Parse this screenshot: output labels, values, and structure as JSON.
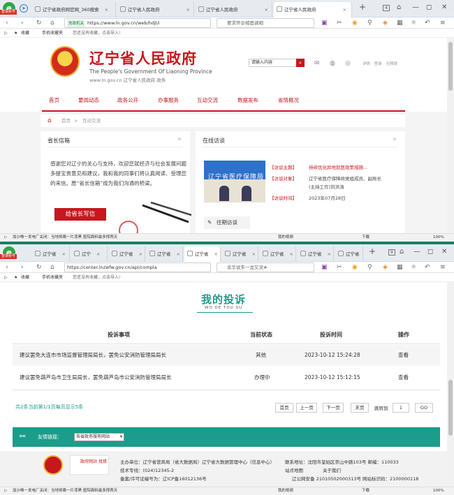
{
  "window1": {
    "badge": "登录账号",
    "tabs": [
      {
        "label": "辽宁省政府网官网_360搜索",
        "close": "×"
      },
      {
        "label": "辽宁省人民政府",
        "close": "×"
      },
      {
        "label": "辽宁省人民政府",
        "close": "×"
      },
      {
        "label": "辽宁省人民政府",
        "close": "×"
      }
    ],
    "new_tab": "+",
    "tab_count": "4",
    "address": {
      "safe_label": "党政机关",
      "url": "https://www.ln.gov.cn/web/hdjl/i"
    },
    "search_placeholder": "要求怀孕相面调相",
    "bookmarks": {
      "fav": "收藏",
      "mobile": "手机收藏夹",
      "hint": "您还没有收藏，点击导入!"
    },
    "status": {
      "news": "加沙唯一发电厂关闭：当地将晚一片漆黑 医院面料最多撑两天",
      "video": "我的视频",
      "download": "下载",
      "zoom": "100%"
    }
  },
  "gov": {
    "title": "辽宁省人民政府",
    "subtitle_en": "The People's Government Of Liaoning Province",
    "site": "www.ln.gov.cn  辽宁省人民政府 政务",
    "search_placeholder": "请输入内容",
    "top_links": "详情  登录  无障碍",
    "nav": [
      "首页",
      "要闻动态",
      "政务公开",
      "办事服务",
      "互动交流",
      "数据发布",
      "省情概况"
    ],
    "breadcrumb": [
      "首页",
      "互动交流"
    ],
    "left_panel": {
      "title": "省长信箱",
      "body": "感谢您对辽宁的关心与支持，欢迎您就经济与社会发展问题多提宝贵意见和建议，我和我的同事们将认真阅读、受理您的来信。愿“省长信箱”成为我们沟通的桥梁。",
      "button": "给省长写信"
    },
    "right_panel": {
      "title": "在线访谈",
      "photo_text": "辽宁省医疗保障局",
      "rows": [
        {
          "key": "【访谈主题】",
          "value": "持续优化异地就医政策措施..."
        },
        {
          "key": "【访谈对象】",
          "value": "辽宁省医疗保障局党组成员、副局长(主持工作)刘洪涛"
        },
        {
          "key": "【访谈时间】",
          "value": "2023年07月28日"
        }
      ],
      "past_button": "往期访谈"
    }
  },
  "window2": {
    "badge": "登录账号",
    "tabs": [
      {
        "label": "辽宁省",
        "close": "×"
      },
      {
        "label": "辽宁",
        "close": "×"
      },
      {
        "label": "辽宁省",
        "close": "×"
      },
      {
        "label": "辽宁省",
        "close": "×"
      },
      {
        "label": "辽宁省",
        "close": "×"
      },
      {
        "label": "辽宁省",
        "close": "×"
      },
      {
        "label": "辽宁省",
        "close": "×"
      },
      {
        "label": "辽宁省",
        "close": "×"
      },
      {
        "label": "辽宁省",
        "close": "×"
      }
    ],
    "new_tab": "+",
    "tab_count": "9",
    "address": {
      "url": "https://center.lnzwfw.gov.cn/api/compla"
    },
    "search_placeholder": "余华说朱一龙又没#",
    "bookmarks": {
      "fav": "收藏",
      "mobile": "手机收藏夹",
      "hint": "您还没有收藏，点击导入!"
    },
    "status": {
      "news": "加沙唯一发电厂关闭：当地将晚一片漆黑 医院面料最多撑两天",
      "video": "我的视频",
      "download": "下载",
      "zoom": "100%"
    }
  },
  "complaints": {
    "title": "我的投诉",
    "subtitle": "WO DE TOU SU",
    "headers": [
      "投诉事项",
      "当前状态",
      "投诉时间",
      "操作"
    ],
    "rows": [
      {
        "item": "建议罢免大连市市场监督管理局局长，罢免公安消防管理局局长",
        "status": "其他",
        "time": "2023-10-12 15:24:28",
        "action": "查看"
      },
      {
        "item": "建议罢免葫芦岛市卫生局局长，罢免葫芦岛市公安消防管理局局长",
        "status": "办理中",
        "time": "2023-10-12 15:12:15",
        "action": "查看"
      }
    ],
    "pagination": {
      "info": "共2条当前第1/1页每页显示5条",
      "first": "首页",
      "prev": "上一页",
      "next": "下一页",
      "last": "末页",
      "jump_label": "跳转到",
      "page_value": "1",
      "go": "GO"
    },
    "friend_links": {
      "label": "友情链接：",
      "select": "各省政务服务网站"
    },
    "footer": {
      "logo2": "政府网站 找错",
      "host": "主办单位：辽宁省营商局（省大数据局）辽宁省大数据管理中心（信息中心）",
      "phone": "技术专线：(024)12345-2",
      "icp": "备案/许可证编号为：辽ICP备16012136号",
      "address": "联系地址：沈阳市皇姑区崇山中路103号  邮编：110033",
      "sitemap": "站点地图",
      "contact": "关于我们",
      "police": "辽公网安备 21010502000313号  网站标识码：2100000118"
    }
  }
}
